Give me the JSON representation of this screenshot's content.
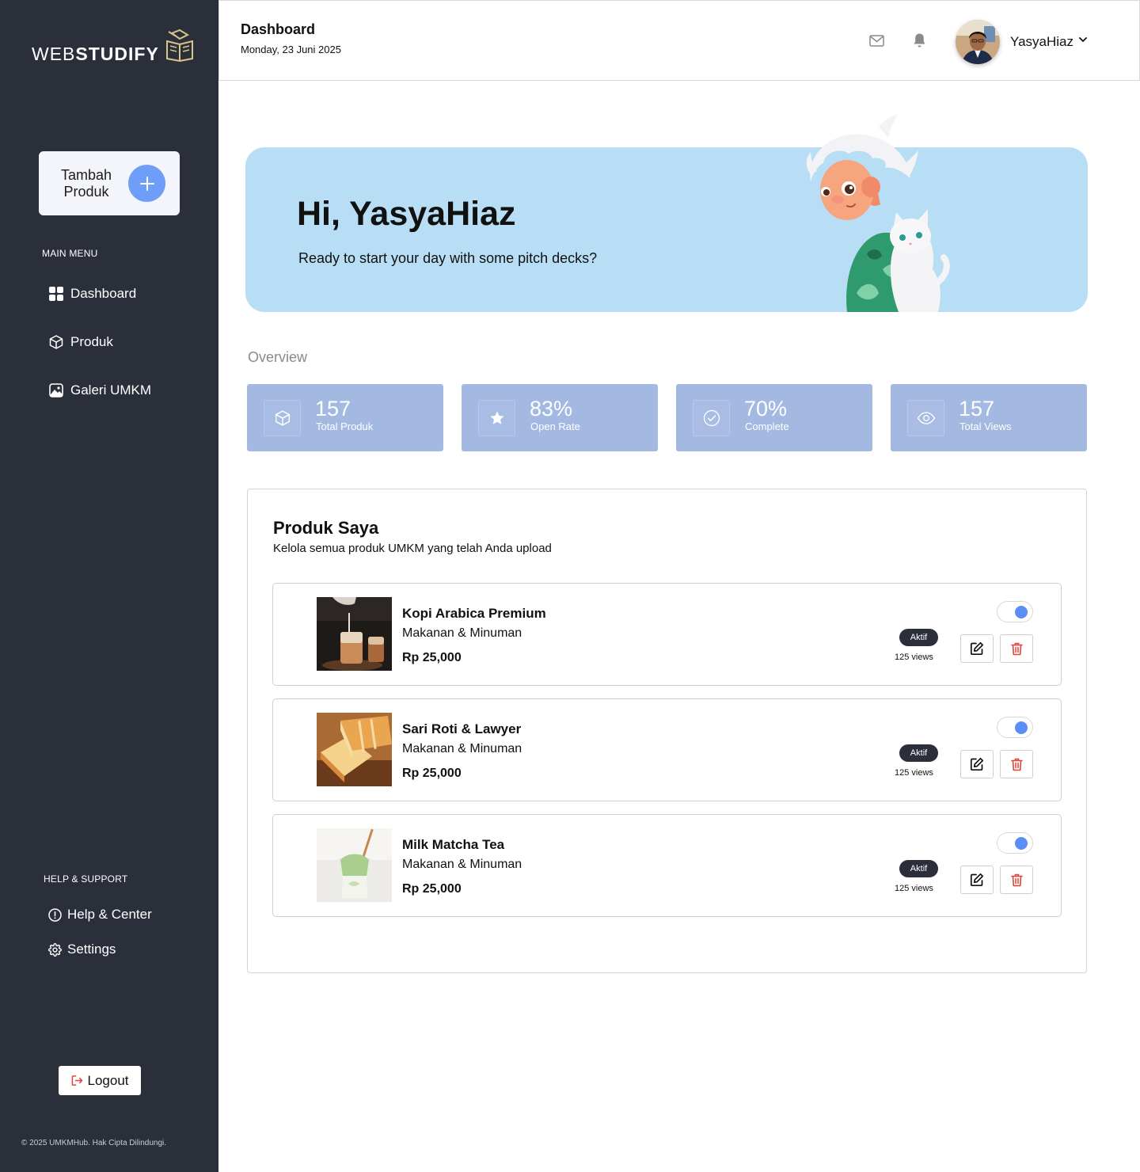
{
  "brand": {
    "logo_light": "WEB",
    "logo_bold": "STUDIFY"
  },
  "sidebar": {
    "add_product_label": "Tambah Produk",
    "main_menu_label": "MAIN MENU",
    "items": [
      {
        "label": "Dashboard",
        "icon": "grid-icon"
      },
      {
        "label": "Produk",
        "icon": "box-icon"
      },
      {
        "label": "Galeri UMKM",
        "icon": "gallery-icon"
      }
    ],
    "help_label": "HELP & SUPPORT",
    "help_items": [
      {
        "label": "Help & Center",
        "icon": "info-icon"
      },
      {
        "label": "Settings",
        "icon": "gear-icon"
      }
    ],
    "logout_label": "Logout",
    "copyright": "© 2025 UMKMHub. Hak Cipta Dilindungi."
  },
  "header": {
    "title": "Dashboard",
    "date": "Monday, 23 Juni 2025",
    "username": "YasyaHiaz"
  },
  "hero": {
    "title": "Hi, YasyaHiaz",
    "subtitle": "Ready to start your day with some pitch decks?"
  },
  "overview": {
    "label": "Overview",
    "stats": [
      {
        "value": "157",
        "label": "Total Produk",
        "icon": "box-icon"
      },
      {
        "value": "83%",
        "label": "Open Rate",
        "icon": "star-icon"
      },
      {
        "value": "70%",
        "label": "Complete",
        "icon": "check-circle-icon"
      },
      {
        "value": "157",
        "label": "Total Views",
        "icon": "eye-icon"
      }
    ]
  },
  "products": {
    "title": "Produk Saya",
    "subtitle": "Kelola semua produk UMKM yang telah Anda upload",
    "items": [
      {
        "name": "Kopi Arabica Premium",
        "category": "Makanan & Minuman",
        "price": "Rp 25,000",
        "status": "Aktif",
        "views": "125 views",
        "active": true
      },
      {
        "name": "Sari Roti & Lawyer",
        "category": "Makanan & Minuman",
        "price": "Rp 25,000",
        "status": "Aktif",
        "views": "125 views",
        "active": true
      },
      {
        "name": "Milk Matcha Tea",
        "category": "Makanan & Minuman",
        "price": "Rp 25,000",
        "status": "Aktif",
        "views": "125 views",
        "active": true
      }
    ]
  },
  "colors": {
    "sidebar_bg": "#2b2f3a",
    "accent": "#6e9ef7",
    "hero_bg": "#b8def5",
    "stat_bg": "#a4b9e2",
    "delete": "#e0433a"
  }
}
